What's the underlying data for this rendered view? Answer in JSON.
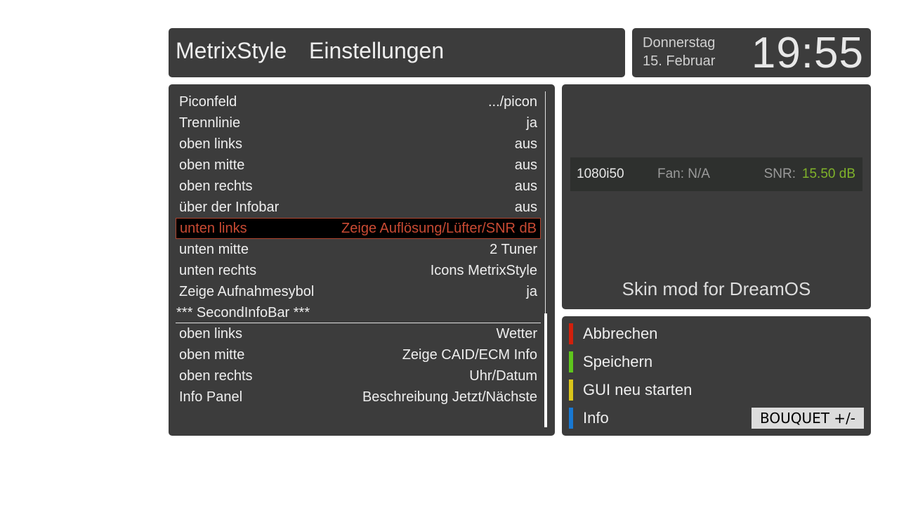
{
  "header": {
    "app_name": "MetrixStyle",
    "screen_title": "Einstellungen"
  },
  "clock": {
    "weekday": "Donnerstag",
    "date": "15. Februar",
    "time": "19:55"
  },
  "settings": {
    "rows": [
      {
        "label": "Piconfeld",
        "value": ".../picon"
      },
      {
        "label": "Trennlinie",
        "value": "ja"
      },
      {
        "label": "oben links",
        "value": "aus"
      },
      {
        "label": "oben mitte",
        "value": "aus"
      },
      {
        "label": "oben rechts",
        "value": "aus"
      },
      {
        "label": "über der Infobar",
        "value": "aus"
      },
      {
        "label": "unten links",
        "value": "Zeige Auflösung/Lüfter/SNR dB"
      },
      {
        "label": "unten mitte",
        "value": "2 Tuner"
      },
      {
        "label": "unten rechts",
        "value": "Icons MetrixStyle"
      },
      {
        "label": "Zeige Aufnahmesybol",
        "value": "ja"
      },
      {
        "label": "*** SecondInfoBar ***",
        "value": ""
      },
      {
        "label": "oben links",
        "value": "Wetter"
      },
      {
        "label": "oben mitte",
        "value": "Zeige CAID/ECM Info"
      },
      {
        "label": "oben rechts",
        "value": "Uhr/Datum"
      },
      {
        "label": "Info Panel",
        "value": "Beschreibung Jetzt/Nächste"
      }
    ],
    "selected_index": 6
  },
  "preview": {
    "resolution": "1080i50",
    "fan": "Fan: N/A",
    "snr_label": "SNR:",
    "snr_value": "15.50 dB",
    "skin_text": "Skin mod for DreamOS"
  },
  "buttons": [
    {
      "label": "Abbrechen",
      "color": "#d2200c"
    },
    {
      "label": "Speichern",
      "color": "#5ec61c"
    },
    {
      "label": "GUI neu starten",
      "color": "#d9c51a"
    },
    {
      "label": "Info",
      "color": "#1878d2"
    }
  ],
  "bouquet_label": "BOUQUET +/-",
  "colors": {
    "panel": "#3c3c3c",
    "selected_text": "#c94a33",
    "snr_value": "#7fb22a"
  }
}
